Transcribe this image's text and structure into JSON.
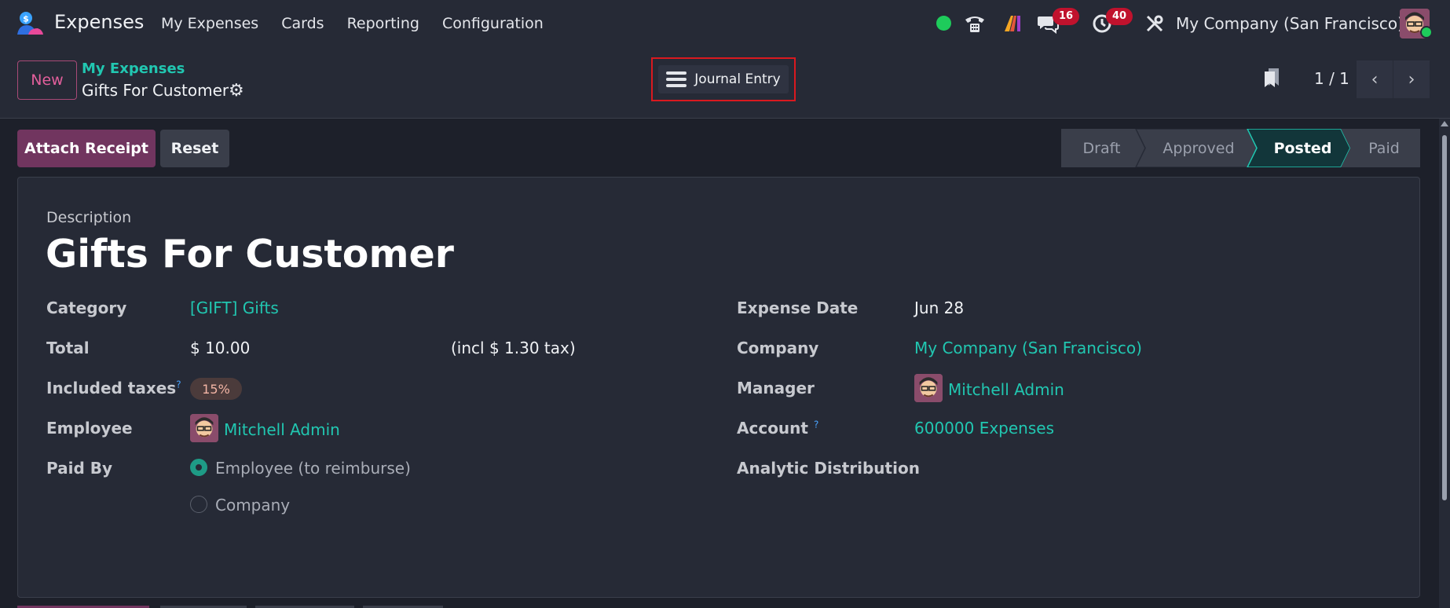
{
  "navbar": {
    "app_name": "Expenses",
    "menu": [
      "My Expenses",
      "Cards",
      "Reporting",
      "Configuration"
    ],
    "messages_count": "16",
    "activities_count": "40",
    "company": "My Company (San Francisco)",
    "icons": [
      "app-logo-icon",
      "status-dot-icon",
      "phone-icon",
      "ai-icon",
      "chat-icon",
      "clock-icon",
      "tools-icon",
      "avatar"
    ]
  },
  "control_panel": {
    "new_label": "New",
    "breadcrumb_parent": "My Expenses",
    "breadcrumb_current": "Gifts For Customer",
    "smart_button": "Journal Entry",
    "pager": "1 / 1"
  },
  "actions": {
    "attach_receipt": "Attach Receipt",
    "reset": "Reset"
  },
  "status_stages": [
    {
      "label": "Draft",
      "active": false
    },
    {
      "label": "Approved",
      "active": false
    },
    {
      "label": "Posted",
      "active": true
    },
    {
      "label": "Paid",
      "active": false
    }
  ],
  "form": {
    "description_label": "Description",
    "title": "Gifts For Customer",
    "left": {
      "category_label": "Category",
      "category_value": "[GIFT] Gifts",
      "total_label": "Total",
      "total_value": "$ 10.00",
      "total_tax_note": "(incl $ 1.30 tax)",
      "included_taxes_label": "Included taxes",
      "included_taxes_value": "15%",
      "employee_label": "Employee",
      "employee_value": "Mitchell Admin",
      "paid_by_label": "Paid By",
      "paid_by_options": [
        "Employee (to reimburse)",
        "Company"
      ],
      "paid_by_selected": "Employee (to reimburse)"
    },
    "right": {
      "expense_date_label": "Expense Date",
      "expense_date_value": "Jun 28",
      "company_label": "Company",
      "company_value": "My Company (San Francisco)",
      "manager_label": "Manager",
      "manager_value": "Mitchell Admin",
      "account_label": "Account",
      "account_value": "600000 Expenses",
      "analytic_label": "Analytic Distribution"
    },
    "help_marker": "?"
  },
  "colors": {
    "background": "#262a36",
    "content_bg": "#1d202a",
    "accent_teal": "#21c7b1",
    "primary_purple": "#71355f",
    "badge_red": "#c0122d",
    "online_green": "#1ecb5b"
  }
}
